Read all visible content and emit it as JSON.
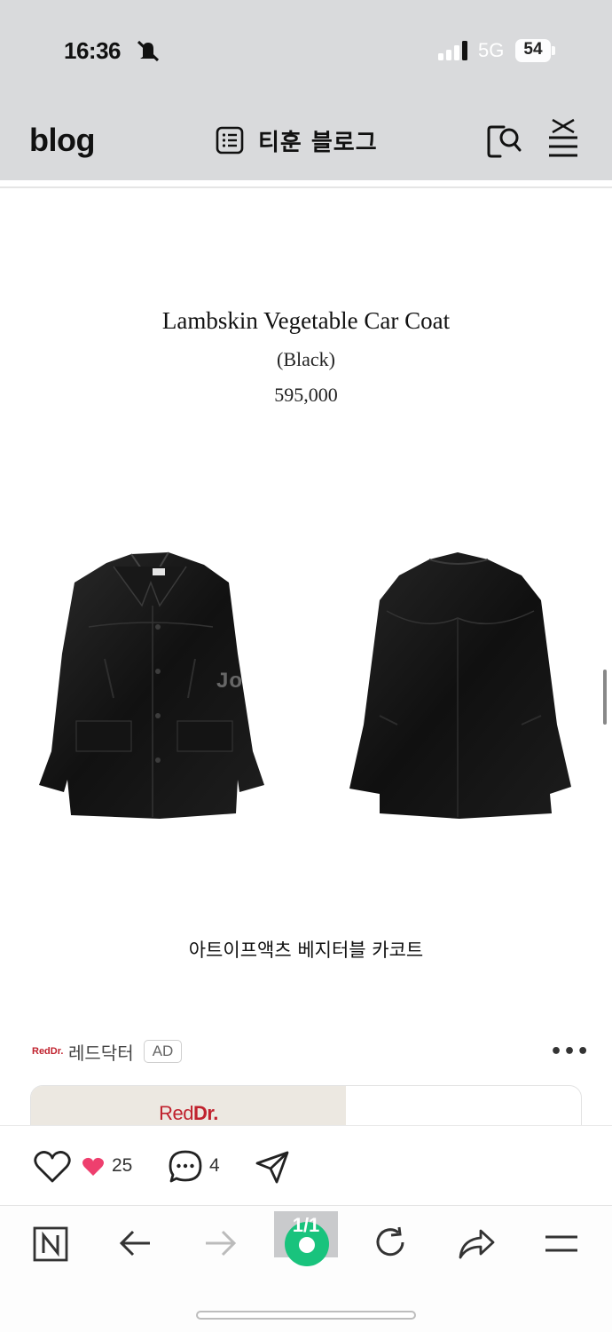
{
  "status_bar": {
    "time": "16:36",
    "network": "5G",
    "battery": "54"
  },
  "header": {
    "logo": "blog",
    "blog_title": "티훈 블로그"
  },
  "article": {
    "product_title": "Lambskin Vegetable Car Coat",
    "product_color": "(Black)",
    "product_price": "595,000",
    "image_watermark": "Jo          ara",
    "caption_korean": "아트이프액츠 베지터블 카코트"
  },
  "ad": {
    "advertiser_logo": "RedDr.",
    "advertiser_name": "레드닥터",
    "badge": "AD",
    "more": "•••",
    "card_brand_red": "Red",
    "card_brand_bold": "Dr."
  },
  "reactions": {
    "like_count": "25",
    "comment_count": "4"
  },
  "browser_bar": {
    "tab_count": "1/1"
  },
  "colors": {
    "chrome_bg": "#d9dadc",
    "accent_green": "#19c37d",
    "heart_pink": "#ee3f6e",
    "brand_red": "#c0212d"
  }
}
